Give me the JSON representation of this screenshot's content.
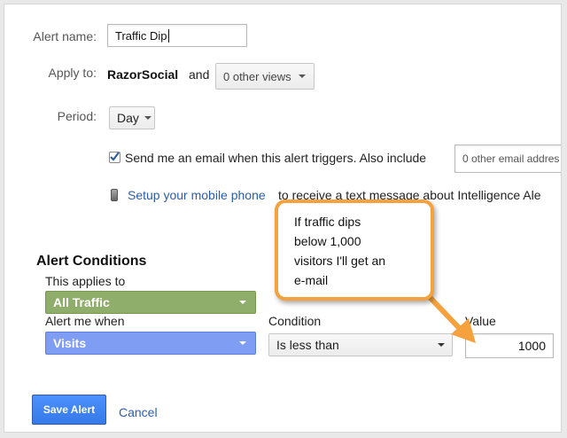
{
  "form": {
    "alert_name_label": "Alert name:",
    "alert_name_value": "Traffic Dip",
    "apply_to_label": "Apply to:",
    "apply_to_site": "RazorSocial",
    "apply_to_and": "and",
    "other_views": "0 other views",
    "period_label": "Period:",
    "period_value": "Day",
    "email_text": "Send me an email when this alert triggers. Also include",
    "email_input_placeholder": "0 other email addres",
    "mobile_link": "Setup your mobile phone",
    "mobile_text": "to receive a text message about Intelligence Ale"
  },
  "conditions": {
    "title": "Alert Conditions",
    "applies_to_label": "This applies to",
    "applies_to_value": "All Traffic",
    "alert_when_label": "Alert me when",
    "alert_when_value": "Visits",
    "condition_label": "Condition",
    "condition_value": "Is less than",
    "value_label": "Value",
    "value_value": "1000"
  },
  "callout": {
    "lines": [
      "If traffic dips",
      "below 1,000",
      "visitors I'll get an",
      "e-mail"
    ]
  },
  "actions": {
    "save_label": "Save Alert",
    "cancel_label": "Cancel"
  },
  "colors": {
    "accent_blue": "#4d90fe",
    "green_select": "#8fae6b",
    "blue_select": "#7f9ef3",
    "callout_border": "#f4a13e",
    "link": "#2a5db0"
  }
}
